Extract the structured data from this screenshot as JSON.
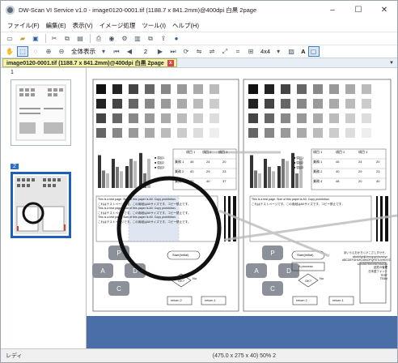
{
  "window": {
    "title": "DW-Scan VI Service v1.0 - image0120-0001.tif (1188.7 x 841.2mm)@400dpi 白黒 2page",
    "minimize": "–",
    "maximize": "☐",
    "close": "✕"
  },
  "menu": [
    "ファイル(F)",
    "編集(E)",
    "表示(V)",
    "イメージ処理",
    "ツール(I)",
    "ヘルプ(H)"
  ],
  "toolbar": {
    "fit_label": "全体表示",
    "page_value": "2",
    "grid_label": "4x4",
    "text_tool": "A"
  },
  "doc_tab": {
    "label": "image0120-0001.tif (1188.7 x 841.2mm)@400dpi 白黒 2page",
    "close": "x"
  },
  "thumbnails": [
    {
      "label": "1",
      "selected": false
    },
    {
      "label": "2",
      "selected": true
    }
  ],
  "page": {
    "table_header": [
      "",
      "項目 1",
      "項目 2",
      "項目 3"
    ],
    "table_rows": [
      [
        "業務 1",
        "45",
        "24",
        "20"
      ],
      [
        "業務 2",
        "40",
        "29",
        "23"
      ],
      [
        "業務 3",
        "30",
        "40",
        "37"
      ],
      [
        "業務 4",
        "48",
        "20",
        "40"
      ]
    ],
    "legend": [
      "■ 項目1",
      "■ 項目2",
      "■ 項目3"
    ],
    "text_lines_en": [
      "This is a test page. Size of this paper is A0. Copy prohibition.",
      "This is a test page. Size of this paper is A0. Copy prohibition.",
      "This is a test page. Size of this paper is A0. Copy prohibition."
    ],
    "text_lines_jp": [
      "これはテストページです。この用紙はA0サイズです。コピー禁止です。",
      "これはテストページです。この用紙はA0サイズです。コピー禁止です。",
      "これはテストページです。この用紙はA0サイズです。コピー禁止です。"
    ],
    "flow_start": "Start(Initial)",
    "flow_process": "A process",
    "flow_ok": "OK?",
    "flow_no": "No",
    "flow_yes": "Yes",
    "flow_ret2": "return 2",
    "flow_ret1": "return 1",
    "bottom_block": [
      "あいうえおかきくけこさしすせそ。",
      "abcdefghijklmnopqrstuvwxyz",
      "ABCDEFGHIJKLMNOPQRSTUVWXYZ",
      "12345678900987654321",
      "品質の管理",
      "日本語フォント",
      "TEST",
      "TEAM"
    ],
    "circle_letters": [
      "P",
      "A",
      "D",
      "C"
    ]
  },
  "status": {
    "left": "レディ",
    "right": "(475.0 x 275 x 40) 50% 2"
  },
  "colors": {
    "viewer_bg": "#4a6fa8",
    "selected_blue": "#2a6fd0",
    "tab_yellow": "#f4f4a8"
  }
}
